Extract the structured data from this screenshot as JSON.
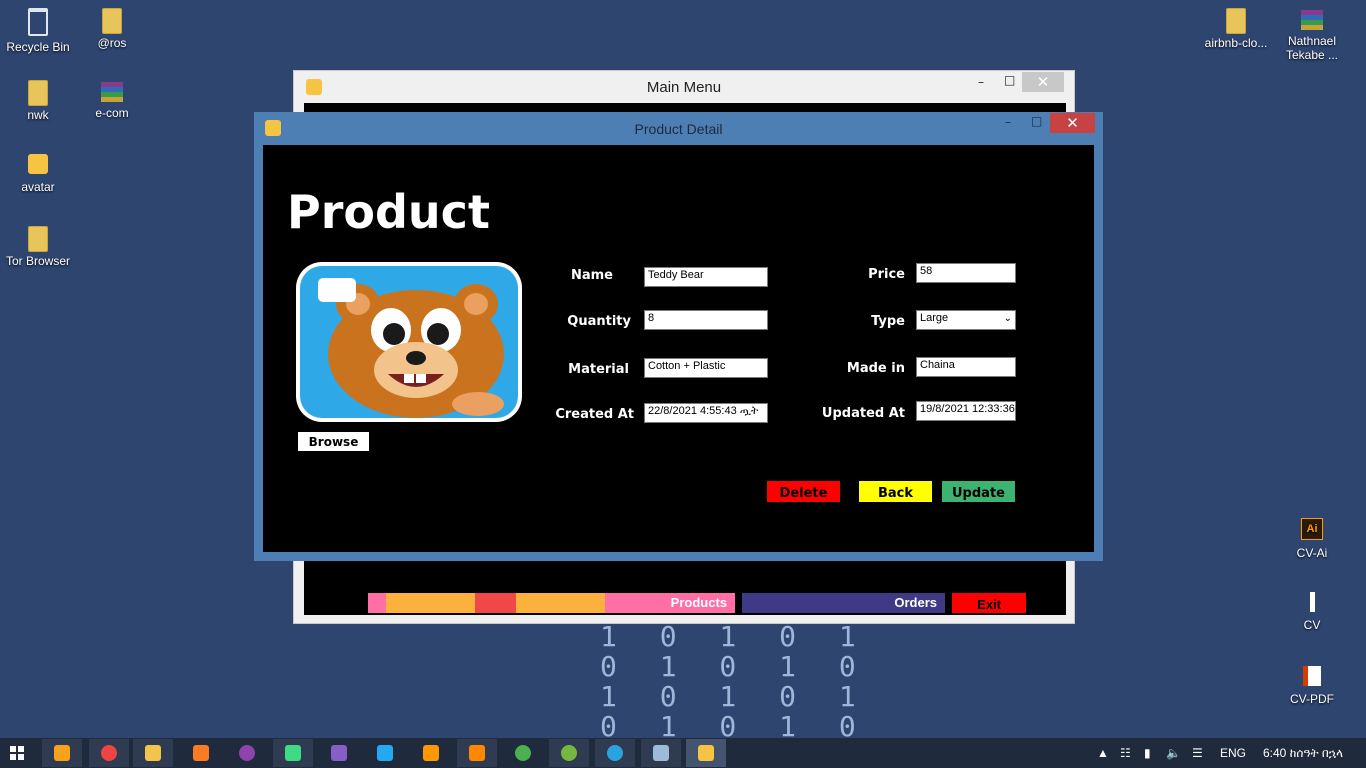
{
  "desktop": {
    "icons_left": [
      {
        "label": "Recycle Bin",
        "icon": "recycle-bin-icon"
      },
      {
        "label": "@ros",
        "icon": "folder-icon"
      },
      {
        "label": "nwk",
        "icon": "folder-icon"
      },
      {
        "label": "e-com",
        "icon": "archive-icon"
      },
      {
        "label": "avatar",
        "icon": "image-icon"
      },
      {
        "label": "Tor Browser",
        "icon": "folder-icon"
      }
    ],
    "icons_right": [
      {
        "label": "airbnb-clo...",
        "icon": "folder-icon"
      },
      {
        "label": "Nathnael Tekabe ...",
        "icon": "archive-icon"
      },
      {
        "label": "CV-Ai",
        "icon": "illustrator-icon"
      },
      {
        "label": "CV",
        "icon": "document-icon"
      },
      {
        "label": "CV-PDF",
        "icon": "pdf-icon"
      }
    ],
    "wallpaper_binary": [
      "1 0 1 0 1",
      "0 1 0 1 0",
      "1 0 1 0 1",
      "0 1 0 1 0"
    ]
  },
  "main_menu": {
    "title": "Main Menu",
    "bars": {
      "products": "Products",
      "orders": "Orders",
      "exit": "Exit"
    }
  },
  "product_detail": {
    "title": "Product Detail",
    "heading": "Product",
    "browse_label": "Browse",
    "fields": {
      "name": {
        "label": "Name",
        "value": "Teddy Bear"
      },
      "quantity": {
        "label": "Quantity",
        "value": "8"
      },
      "material": {
        "label": "Material",
        "value": "Cotton + Plastic"
      },
      "created_at": {
        "label": "Created At",
        "value": "22/8/2021 4:55:43 ጧት"
      },
      "price": {
        "label": "Price",
        "value": "58"
      },
      "type": {
        "label": "Type",
        "value": "Large"
      },
      "made_in": {
        "label": "Made in",
        "value": "Chaina"
      },
      "updated_at": {
        "label": "Updated At",
        "value": "19/8/2021 12:33:36"
      }
    },
    "buttons": {
      "delete": "Delete",
      "back": "Back",
      "update": "Update"
    },
    "colors": {
      "delete": "#ff0000",
      "back": "#ffff00",
      "update": "#3cb371"
    }
  },
  "taskbar": {
    "apps": [
      "search-icon",
      "chrome-icon",
      "file-explorer-icon",
      "xampp-icon",
      "github-icon",
      "android-studio-icon",
      "visual-studio-icon",
      "vscode-icon",
      "sublime-icon",
      "vlc-icon",
      "chrome-icon",
      "utorrent-icon",
      "telegram-icon",
      "remote-desktop-icon",
      "app-icon"
    ],
    "language": "ENG",
    "clock": "6:40 ከሰዓት በኋላ"
  }
}
